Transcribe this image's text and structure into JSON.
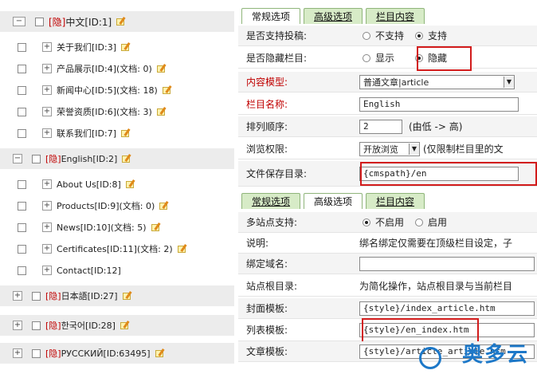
{
  "tree": {
    "items": [
      {
        "hidden_tag": "[隐]",
        "label": "中文[ID:1]"
      },
      {
        "label": "关于我们[ID:3]"
      },
      {
        "label": "产品展示[ID:4](文档: 0)"
      },
      {
        "label": "新闻中心[ID:5](文档: 18)"
      },
      {
        "label": "荣誉资质[ID:6](文档: 3)"
      },
      {
        "label": "联系我们[ID:7]"
      },
      {
        "hidden_tag": "[隐]",
        "label": "English[ID:2]"
      },
      {
        "label": "About Us[ID:8]"
      },
      {
        "label": "Products[ID:9](文档: 0)"
      },
      {
        "label": "News[ID:10](文档: 5)"
      },
      {
        "label": "Certificates[ID:11](文档: 2)"
      },
      {
        "label": "Contact[ID:12]"
      },
      {
        "hidden_tag": "[隐]",
        "label": "日本語[ID:27]"
      },
      {
        "hidden_tag": "[隐]",
        "label": "한국어[ID:28]"
      },
      {
        "hidden_tag": "[隐]",
        "label": "РУССКИЙ[ID:63495]"
      }
    ],
    "expand_symbol": "⊟",
    "collapsed_symbol": "⊞"
  },
  "tabs1": [
    "常规选项",
    "高级选项",
    "栏目内容"
  ],
  "tabs2": [
    "常规选项",
    "高级选项",
    "栏目内容"
  ],
  "form1": {
    "contribute_label": "是否支持投稿:",
    "contribute_no": "不支持",
    "contribute_yes": "支持",
    "hidden_label": "是否隐藏栏目:",
    "hidden_show": "显示",
    "hidden_hide": "隐藏",
    "model_label": "内容模型:",
    "model_value": "普通文章|article",
    "name_label": "栏目名称:",
    "name_value": "English",
    "order_label": "排列顺序:",
    "order_value": "2",
    "order_hint": "(由低 -> 高)",
    "access_label": "浏览权限:",
    "access_value": "开放浏览",
    "access_hint": "(仅限制栏目里的文",
    "dir_label": "文件保存目录:",
    "dir_value": "{cmspath}/en"
  },
  "form2": {
    "multisite_label": "多站点支持:",
    "multisite_off": "不启用",
    "multisite_on": "启用",
    "note_label": "说明:",
    "note_value": "绑名绑定仅需要在顶级栏目设定，子",
    "domain_label": "绑定域名:",
    "domain_value": "",
    "root_label": "站点根目录:",
    "root_value": "为简化操作，站点根目录与当前栏目",
    "cover_label": "封面模板:",
    "cover_value": "{style}/index_article.htm",
    "list_label": "列表模板:",
    "list_value": "{style}/en_index.htm",
    "article_label": "文章模板:",
    "article_value": "{style}/article_article.htm"
  },
  "watermark": {
    "text": "奥多云"
  },
  "colors": {
    "accent_red": "#d21b1b",
    "tab_green": "#d7ebc7",
    "hidden_red": "#c00000"
  }
}
